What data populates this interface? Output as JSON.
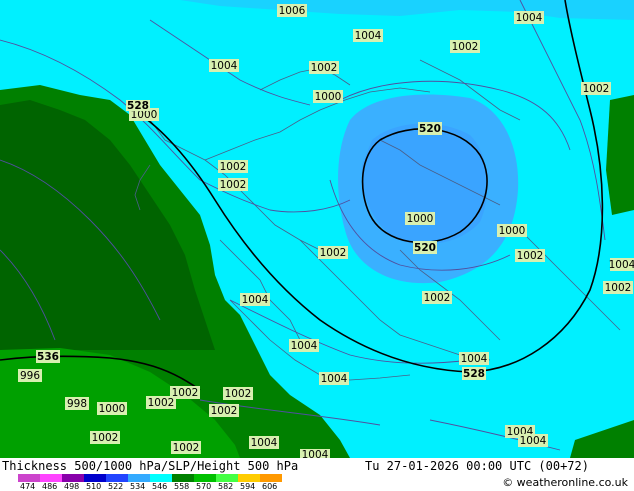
{
  "map": {
    "contour_labels_slp": [
      "1006",
      "1004",
      "1004",
      "1002",
      "1004",
      "1002",
      "1002",
      "1000",
      "1000",
      "1002",
      "1002",
      "1000",
      "1000",
      "1002",
      "1002",
      "1002",
      "1004",
      "1004",
      "1002",
      "1004",
      "1004",
      "1002",
      "1000",
      "1002",
      "1002",
      "1002",
      "1002",
      "1002",
      "1000",
      "1004",
      "1004",
      "1004",
      "1004",
      "1004",
      "1004",
      "1002",
      "1000",
      "996",
      "998",
      "1004"
    ],
    "contour_labels_height": [
      "528",
      "520",
      "520",
      "528",
      "536"
    ],
    "colors": {
      "thickness_528_534": "#00ffff",
      "thickness_522_528": "#29c5ff",
      "thickness_516_522": "#3d9cff",
      "thickness_534_546": "#008f00",
      "thickness_546_552": "#006600",
      "thickness_dark": "#005500",
      "slp_contour": "#5a5aa0",
      "height_contour": "#000000",
      "borders": "#5a6a8a"
    }
  },
  "footer": {
    "title": "Thickness 500/1000 hPa/SLP/Height 500 hPa",
    "datetime": "Tu 27-01-2026 00:00 UTC (00+72)",
    "copyright": "© weatheronline.co.uk",
    "legend_ticks": [
      "474",
      "486",
      "498",
      "510",
      "522",
      "534",
      "546",
      "558",
      "570",
      "582",
      "594",
      "606"
    ],
    "legend_colors": [
      "#cc44cc",
      "#ff44ff",
      "#8800aa",
      "#0000cc",
      "#2244ff",
      "#33aaff",
      "#00ffff",
      "#008000",
      "#00c000",
      "#44ff44",
      "#ffcc00",
      "#ff9900"
    ]
  }
}
